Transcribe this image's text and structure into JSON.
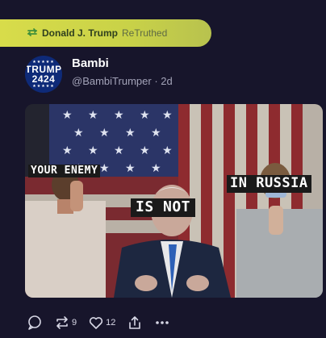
{
  "retruth": {
    "user": "Donald J. Trump",
    "action": "ReTruthed",
    "icon": "retruth-icon",
    "color": "#d8dc4a"
  },
  "post": {
    "avatar": {
      "line1": "TRUMP",
      "line2": "2424",
      "stars": "★★★★★"
    },
    "display_name": "Bambi",
    "handle": "@BambiTrumper",
    "time": "2d",
    "meme": {
      "caption_left": "YOUR ENEMY",
      "caption_center": "IS NOT",
      "caption_right": "IN RUSSIA"
    }
  },
  "actions": {
    "reply": {
      "icon": "reply-icon"
    },
    "retruth": {
      "icon": "retruth-icon",
      "count": "9"
    },
    "like": {
      "icon": "heart-icon",
      "count": "12"
    },
    "share": {
      "icon": "share-icon"
    },
    "more": {
      "icon": "more-icon"
    }
  }
}
